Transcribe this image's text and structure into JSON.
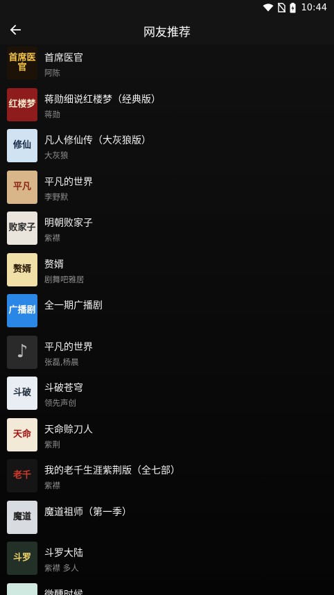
{
  "status_bar": {
    "time": "10:44",
    "icons": [
      "wifi-icon",
      "no-sim-icon",
      "battery-icon"
    ]
  },
  "header": {
    "title": "网友推荐",
    "back_icon": "arrow-left-icon"
  },
  "items": [
    {
      "title": "首席医官",
      "author": "阿陈",
      "cover_text": "首席医官",
      "cover_bg": "#1c1208",
      "cover_fg": "#f5c542"
    },
    {
      "title": "蒋勋细说红楼梦（经典版）",
      "author": "蒋勋",
      "cover_text": "红楼梦",
      "cover_bg": "#8e1c1c",
      "cover_fg": "#f4e6c8"
    },
    {
      "title": "凡人修仙传（大灰狼版）",
      "author": "大灰狼",
      "cover_text": "修仙",
      "cover_bg": "#cfe3f2",
      "cover_fg": "#1b2a44"
    },
    {
      "title": "平凡的世界",
      "author": "李野默",
      "cover_text": "平凡",
      "cover_bg": "#d9b68a",
      "cover_fg": "#8a2616"
    },
    {
      "title": "明朝败家子",
      "author": "紫襟",
      "cover_text": "败家子",
      "cover_bg": "#e9e4dc",
      "cover_fg": "#2a2a2a"
    },
    {
      "title": "赘婿",
      "author": "剧舞吧雅居",
      "cover_text": "赘婿",
      "cover_bg": "#f0e0a8",
      "cover_fg": "#2b1a06"
    },
    {
      "title": "全一期广播剧",
      "author": "",
      "cover_text": "广播剧",
      "cover_bg": "#2b87e6",
      "cover_fg": "#ffffff"
    },
    {
      "title": "平凡的世界",
      "author": "张磊,杨晨",
      "cover_text": "♪",
      "cover_bg": "#2a2a2a",
      "cover_fg": "#bdbdbd"
    },
    {
      "title": "斗破苍穹",
      "author": "领先声创",
      "cover_text": "斗破",
      "cover_bg": "#e8eef3",
      "cover_fg": "#1e2c3a"
    },
    {
      "title": "天命赊刀人",
      "author": "紫荆",
      "cover_text": "天命",
      "cover_bg": "#f2ead6",
      "cover_fg": "#a11414"
    },
    {
      "title": "我的老千生涯紫荆版（全七部）",
      "author": "紫襟",
      "cover_text": "老千",
      "cover_bg": "#151515",
      "cover_fg": "#d23b2b"
    },
    {
      "title": "魔道祖师（第一季）",
      "author": "",
      "cover_text": "魔道",
      "cover_bg": "#d8dbe0",
      "cover_fg": "#1b1b1b"
    },
    {
      "title": "斗罗大陆",
      "author": "紫襟 多人",
      "cover_text": "斗罗",
      "cover_bg": "#223027",
      "cover_fg": "#f1d36a"
    },
    {
      "title": "微醺时候",
      "author": "",
      "cover_text": "",
      "cover_bg": "#cfe8e0",
      "cover_fg": "#333333"
    }
  ]
}
